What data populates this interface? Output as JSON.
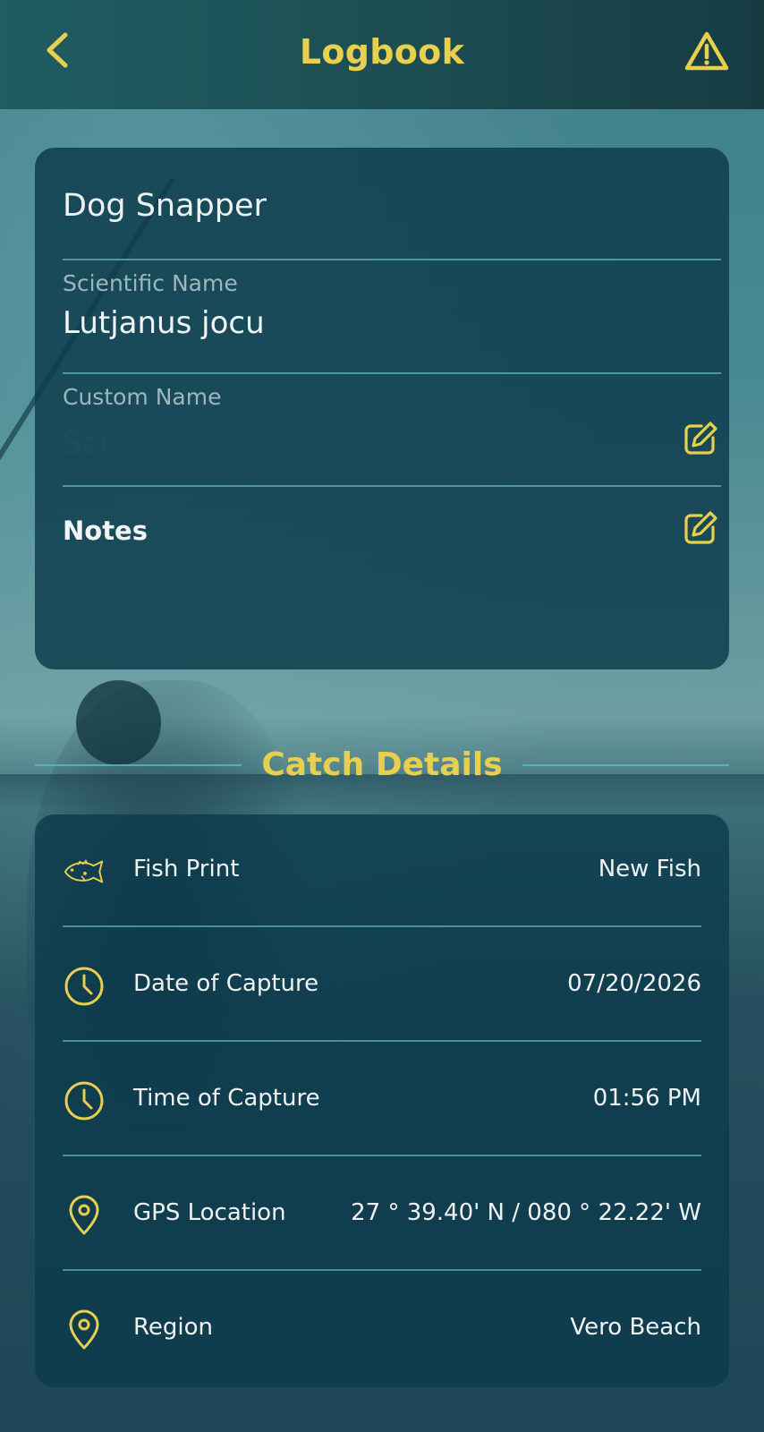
{
  "colors": {
    "accent": "#e8cf4e",
    "card_bg": "#0d3c4c",
    "divider": "#60b2bc"
  },
  "header": {
    "title": "Logbook",
    "back_icon": "chevron-left-icon",
    "warning_icon": "warning-triangle-icon"
  },
  "species_card": {
    "common_name": "Dog Snapper",
    "scientific_label": "Scientific Name",
    "scientific_value": "Lutjanus jocu",
    "custom_label": "Custom Name",
    "custom_value": "",
    "custom_placeholder": "Sci",
    "notes_label": "Notes",
    "edit_icon": "pencil-square-icon"
  },
  "section": {
    "title": "Catch Details"
  },
  "details": [
    {
      "icon": "fish-icon",
      "label": "Fish Print",
      "value": "New Fish"
    },
    {
      "icon": "clock-icon",
      "label": "Date of Capture",
      "value": "07/20/2026"
    },
    {
      "icon": "clock-icon",
      "label": "Time of Capture",
      "value": "01:56 PM"
    },
    {
      "icon": "map-pin-icon",
      "label": "GPS Location",
      "value": "27 ° 39.40' N / 080 ° 22.22' W"
    },
    {
      "icon": "map-pin-icon",
      "label": "Region",
      "value": "Vero Beach"
    }
  ]
}
